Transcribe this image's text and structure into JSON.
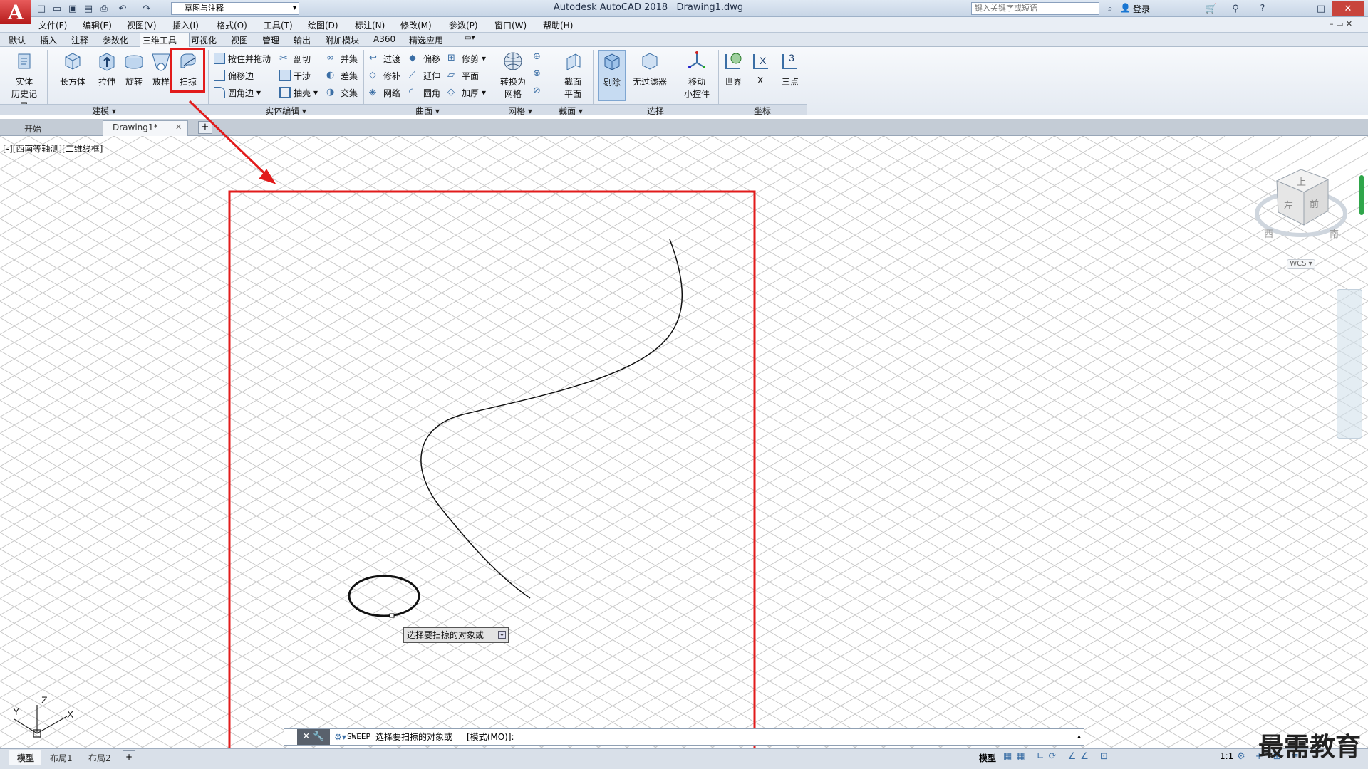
{
  "title_bar": {
    "app_title": "Autodesk AutoCAD 2018",
    "file_name": "Drawing1.dwg",
    "workspace": "草图与注释",
    "search_placeholder": "键入关键字或短语",
    "login_label": "登录"
  },
  "menu": [
    "文件(F)",
    "编辑(E)",
    "视图(V)",
    "插入(I)",
    "格式(O)",
    "工具(T)",
    "绘图(D)",
    "标注(N)",
    "修改(M)",
    "参数(P)",
    "窗口(W)",
    "帮助(H)"
  ],
  "ribbon_tabs": [
    "默认",
    "插入",
    "注释",
    "参数化",
    "三维工具",
    "可视化",
    "视图",
    "管理",
    "输出",
    "附加模块",
    "A360",
    "精选应用"
  ],
  "ribbon": {
    "history_btn": [
      "实体",
      "历史记录"
    ],
    "modeling": {
      "box": "长方体",
      "extrude": "拉伸",
      "revolve": "旋转",
      "loft": "放样",
      "sweep": "扫掠",
      "title": "建模"
    },
    "solid_edit": {
      "presspull": "按住并拖动",
      "offset_edge": "偏移边",
      "fillet_edge": "圆角边",
      "slice": "剖切",
      "interfere": "干涉",
      "shell": "抽壳",
      "union": "并集",
      "subtract": "差集",
      "intersect": "交集",
      "title": "实体编辑"
    },
    "surface": {
      "blend": "过渡",
      "patch": "修补",
      "network": "网络",
      "offset": "偏移",
      "extend": "延伸",
      "fillet": "圆角",
      "trim": "修剪",
      "planar": "平面",
      "thicken": "加厚",
      "title": "曲面"
    },
    "mesh": {
      "convert": [
        "转换为",
        "网格"
      ],
      "title": "网格"
    },
    "section": {
      "plane": [
        "截面",
        "平面"
      ],
      "title": "截面"
    },
    "selection": {
      "cull": "剔除",
      "no_filter": "无过滤器",
      "gizmo": [
        "移动",
        "小控件"
      ],
      "title": "选择"
    },
    "coordinates": {
      "world": "世界",
      "x": "X",
      "three_point": "三点",
      "title": "坐标"
    }
  },
  "doc_tabs": {
    "start": "开始",
    "drawing": "Drawing1*"
  },
  "viewport_label": "[-][西南等轴测][二维线框]",
  "viewcube": {
    "top": "上",
    "left": "左",
    "front": "前",
    "west": "西",
    "south": "南",
    "wcs": "WCS"
  },
  "tooltip": "选择要扫掠的对象或",
  "command_line": {
    "cmd": "SWEEP",
    "prompt": "选择要扫掠的对象或",
    "option": "[模式(MO)]:"
  },
  "layout_tabs": [
    "模型",
    "布局1",
    "布局2"
  ],
  "status": {
    "model": "模型",
    "scale": "1:1"
  },
  "watermark": "最需教育",
  "accent_red": "#e21b1b"
}
